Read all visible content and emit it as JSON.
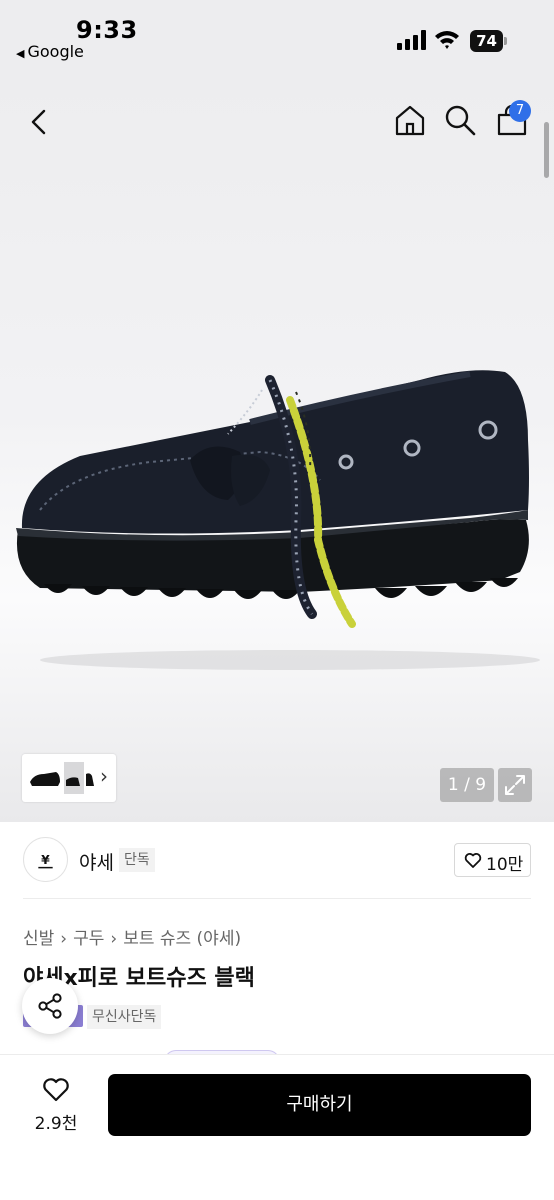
{
  "status_bar": {
    "time": "9:33",
    "back_app": "Google",
    "battery": "74"
  },
  "header": {
    "icons": [
      "chevron-left-icon",
      "home-icon",
      "search-icon",
      "shopping-bag-icon"
    ],
    "cart_count": "7"
  },
  "gallery": {
    "counter": "1 / 9",
    "image_index": 1,
    "image_total": 9
  },
  "brand": {
    "name": "야세",
    "tag": "단독",
    "like_count": "10만"
  },
  "product": {
    "breadcrumb": [
      "신발",
      "구두",
      "보트 슈즈 (야세)"
    ],
    "title": "야세x피로 보트슈즈 블랙",
    "exclusive_tag": "무신사단독"
  },
  "bottom_bar": {
    "wish_count": "2.9천",
    "buy_label": "구매하기"
  },
  "colors": {
    "badge_blue": "#2f6fe8",
    "buy_button": "#000000",
    "tag_purple": "#8b7ed3",
    "lace_yellow": "#c9d13a"
  }
}
